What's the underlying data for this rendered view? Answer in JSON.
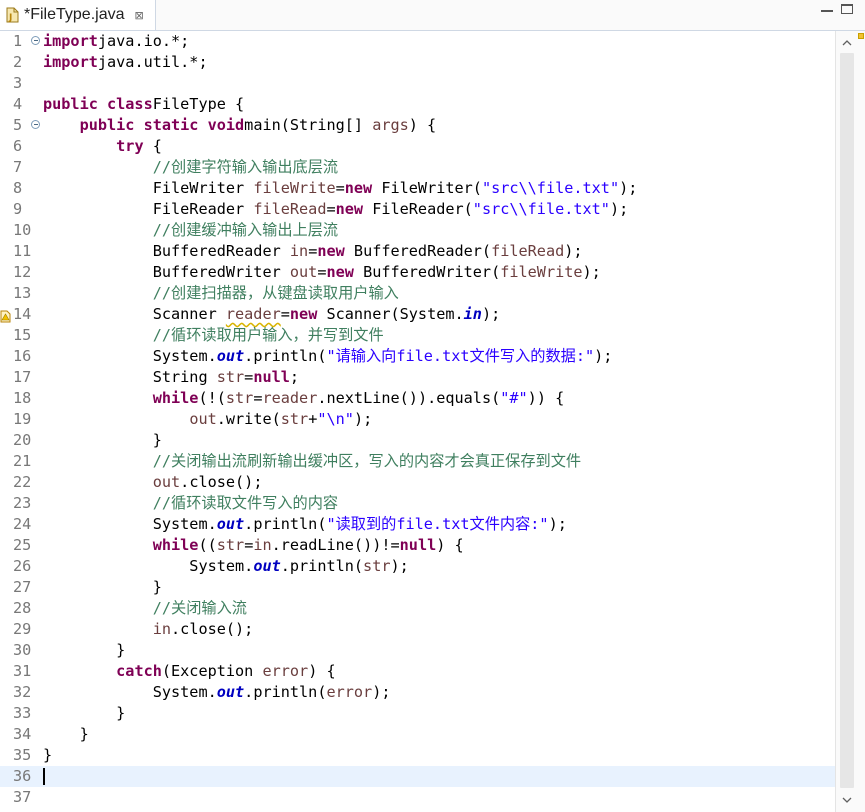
{
  "tab": {
    "title": "*FileType.java",
    "close_glyph": "⊠",
    "icon": "java-file-modified-icon"
  },
  "window_controls": [
    "minimize",
    "maximize"
  ],
  "colors": {
    "keyword": "#7f0055",
    "string": "#2a00ff",
    "comment": "#3f7f5f",
    "static_field": "#0000c0",
    "local_variable": "#6a3e3e",
    "current_line": "#e8f2fe",
    "line_number": "#787878"
  },
  "editor": {
    "current_line": 36,
    "folded_lines": [
      1,
      5
    ],
    "warning_lines": [
      14
    ],
    "lines": [
      [
        [
          "kw",
          "import"
        ],
        [
          "",
          "java.io.*;"
        ]
      ],
      [
        [
          "kw",
          "import"
        ],
        [
          "",
          "java.util.*;"
        ]
      ],
      [],
      [
        [
          "kw",
          "public class"
        ],
        [
          "",
          "FileType {"
        ]
      ],
      [
        [
          "",
          "    "
        ],
        [
          "kw",
          "public static void"
        ],
        [
          "",
          "main(String[] "
        ],
        [
          "var",
          "args"
        ],
        [
          "",
          ") {"
        ]
      ],
      [
        [
          "",
          "        "
        ],
        [
          "kw",
          "try"
        ],
        [
          "",
          " {"
        ]
      ],
      [
        [
          "",
          "            "
        ],
        [
          "cm",
          "//创建字符输入输出底层流"
        ]
      ],
      [
        [
          "",
          "            FileWriter "
        ],
        [
          "var",
          "fileWrite"
        ],
        [
          "",
          "="
        ],
        [
          "kw",
          "new"
        ],
        [
          "",
          " FileWriter("
        ],
        [
          "str",
          "\"src\\\\file.txt\""
        ],
        [
          "",
          ");"
        ]
      ],
      [
        [
          "",
          "            FileReader "
        ],
        [
          "var",
          "fileRead"
        ],
        [
          "",
          "="
        ],
        [
          "kw",
          "new"
        ],
        [
          "",
          " FileReader("
        ],
        [
          "str",
          "\"src\\\\file.txt\""
        ],
        [
          "",
          ");"
        ]
      ],
      [
        [
          "",
          "            "
        ],
        [
          "cm",
          "//创建缓冲输入输出上层流"
        ]
      ],
      [
        [
          "",
          "            BufferedReader "
        ],
        [
          "var",
          "in"
        ],
        [
          "",
          "="
        ],
        [
          "kw",
          "new"
        ],
        [
          "",
          " BufferedReader("
        ],
        [
          "var",
          "fileRead"
        ],
        [
          "",
          ");"
        ]
      ],
      [
        [
          "",
          "            BufferedWriter "
        ],
        [
          "var",
          "out"
        ],
        [
          "",
          "="
        ],
        [
          "kw",
          "new"
        ],
        [
          "",
          " BufferedWriter("
        ],
        [
          "var",
          "fileWrite"
        ],
        [
          "",
          ");"
        ]
      ],
      [
        [
          "",
          "            "
        ],
        [
          "cm",
          "//创建扫描器，从键盘读取用户输入"
        ]
      ],
      [
        [
          "",
          "            Scanner "
        ],
        [
          "varw",
          "reader"
        ],
        [
          "",
          "="
        ],
        [
          "kw",
          "new"
        ],
        [
          "",
          " Scanner(System."
        ],
        [
          "fld",
          "in"
        ],
        [
          "",
          ");"
        ]
      ],
      [
        [
          "",
          "            "
        ],
        [
          "cm",
          "//循环读取用户输入，并写到文件"
        ]
      ],
      [
        [
          "",
          "            System."
        ],
        [
          "fld",
          "out"
        ],
        [
          "",
          ".println("
        ],
        [
          "str",
          "\"请输入向file.txt文件写入的数据:\""
        ],
        [
          "",
          ");"
        ]
      ],
      [
        [
          "",
          "            String "
        ],
        [
          "var",
          "str"
        ],
        [
          "",
          "="
        ],
        [
          "kw",
          "null"
        ],
        [
          "",
          ";"
        ]
      ],
      [
        [
          "",
          "            "
        ],
        [
          "kw",
          "while"
        ],
        [
          "",
          "(!("
        ],
        [
          "var",
          "str"
        ],
        [
          "",
          "="
        ],
        [
          "var",
          "reader"
        ],
        [
          "",
          ".nextLine()).equals("
        ],
        [
          "str",
          "\"#\""
        ],
        [
          "",
          ")) {"
        ]
      ],
      [
        [
          "",
          "                "
        ],
        [
          "var",
          "out"
        ],
        [
          "",
          ".write("
        ],
        [
          "var",
          "str"
        ],
        [
          "",
          "+"
        ],
        [
          "str",
          "\"\\n\""
        ],
        [
          "",
          ");"
        ]
      ],
      [
        [
          "",
          "            }"
        ]
      ],
      [
        [
          "",
          "            "
        ],
        [
          "cm",
          "//关闭输出流刷新输出缓冲区，写入的内容才会真正保存到文件"
        ]
      ],
      [
        [
          "",
          "            "
        ],
        [
          "var",
          "out"
        ],
        [
          "",
          ".close();"
        ]
      ],
      [
        [
          "",
          "            "
        ],
        [
          "cm",
          "//循环读取文件写入的内容"
        ]
      ],
      [
        [
          "",
          "            System."
        ],
        [
          "fld",
          "out"
        ],
        [
          "",
          ".println("
        ],
        [
          "str",
          "\"读取到的file.txt文件内容:\""
        ],
        [
          "",
          ");"
        ]
      ],
      [
        [
          "",
          "            "
        ],
        [
          "kw",
          "while"
        ],
        [
          "",
          "(("
        ],
        [
          "var",
          "str"
        ],
        [
          "",
          "="
        ],
        [
          "var",
          "in"
        ],
        [
          "",
          ".readLine())!="
        ],
        [
          "kw",
          "null"
        ],
        [
          "",
          ") {"
        ]
      ],
      [
        [
          "",
          "                System."
        ],
        [
          "fld",
          "out"
        ],
        [
          "",
          ".println("
        ],
        [
          "var",
          "str"
        ],
        [
          "",
          ");"
        ]
      ],
      [
        [
          "",
          "            }"
        ]
      ],
      [
        [
          "",
          "            "
        ],
        [
          "cm",
          "//关闭输入流"
        ]
      ],
      [
        [
          "",
          "            "
        ],
        [
          "var",
          "in"
        ],
        [
          "",
          ".close();"
        ]
      ],
      [
        [
          "",
          "        }"
        ]
      ],
      [
        [
          "",
          "        "
        ],
        [
          "kw",
          "catch"
        ],
        [
          "",
          "(Exception "
        ],
        [
          "var",
          "error"
        ],
        [
          "",
          ") {"
        ]
      ],
      [
        [
          "",
          "            System."
        ],
        [
          "fld",
          "out"
        ],
        [
          "",
          ".println("
        ],
        [
          "var",
          "error"
        ],
        [
          "",
          ");"
        ]
      ],
      [
        [
          "",
          "        }"
        ]
      ],
      [
        [
          "",
          "    }"
        ]
      ],
      [
        [
          "",
          "}"
        ]
      ],
      [],
      []
    ]
  }
}
